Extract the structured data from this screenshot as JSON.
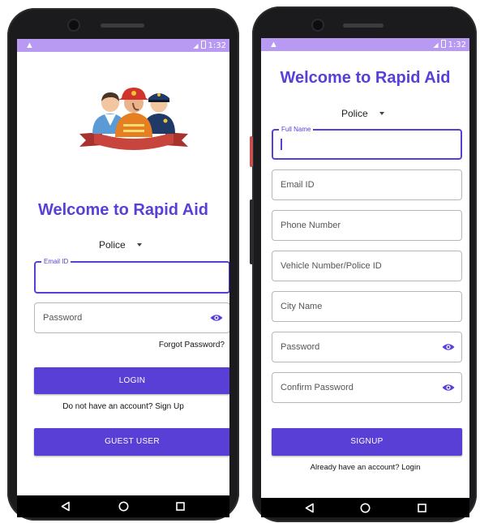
{
  "left_screen": {
    "title": "Welcome to Rapid Aid",
    "role_select": {
      "selected": "Police"
    },
    "email_field": {
      "floating_label": "Email ID",
      "value": ""
    },
    "password_field": {
      "placeholder": "Password"
    },
    "forgot_password": "Forgot Password?",
    "login_button": "LOGIN",
    "signup_prompt": "Do not have an account? Sign Up",
    "guest_button": "GUEST USER"
  },
  "right_screen": {
    "title": "Welcome to Rapid Aid",
    "role_select": {
      "selected": "Police"
    },
    "full_name_field": {
      "floating_label": "Full Name",
      "value": ""
    },
    "email_field": {
      "placeholder": "Email ID"
    },
    "phone_field": {
      "placeholder": "Phone Number"
    },
    "vehicle_field": {
      "placeholder": "Vehicle Number/Police ID"
    },
    "city_field": {
      "placeholder": "City Name"
    },
    "password_field": {
      "placeholder": "Password"
    },
    "confirm_password_field": {
      "placeholder": "Confirm Password"
    },
    "signup_button": "SIGNUP",
    "login_prompt": "Already have an account? Login"
  },
  "status_bar": {
    "time": "1:32",
    "left_icon": "warning-icon"
  },
  "colors": {
    "accent": "#5a3fd6",
    "status_bar": "#b99af2",
    "phone_body": "#1b1b1d",
    "ribbon": "#c8453e"
  },
  "icons": [
    "warning-icon",
    "signal-icon",
    "battery-icon",
    "eye-icon",
    "back-icon",
    "home-icon",
    "recents-icon",
    "responders-illustration"
  ]
}
